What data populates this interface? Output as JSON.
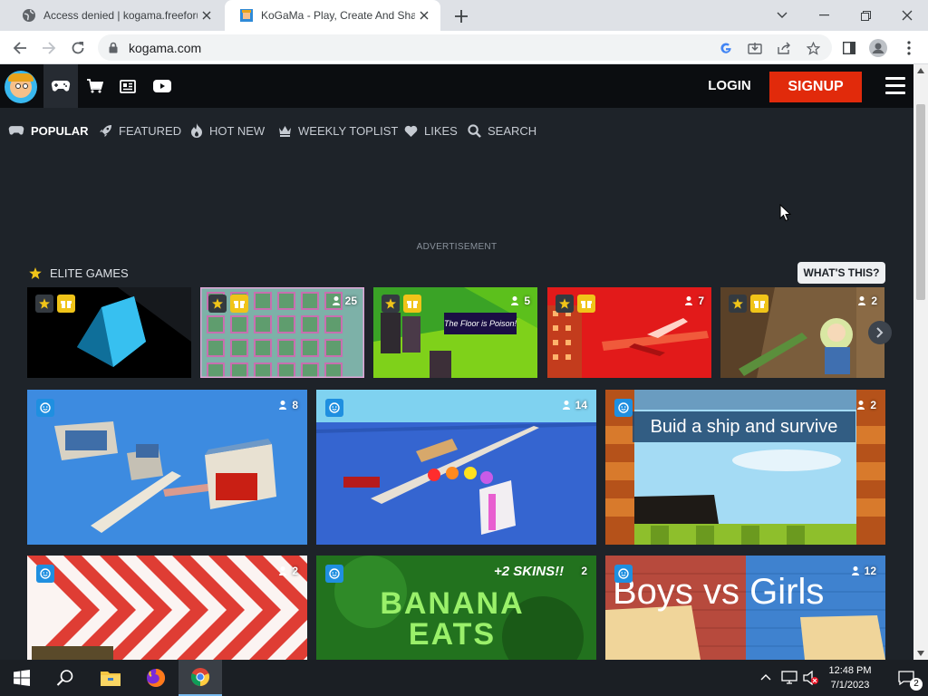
{
  "browser": {
    "tabs": [
      {
        "title": "Access denied | kogama.freeforu",
        "active": false
      },
      {
        "title": "KoGaMa - Play, Create And Share",
        "active": true
      }
    ],
    "url": "kogama.com"
  },
  "header": {
    "login_label": "LOGIN",
    "signup_label": "SIGNUP",
    "accent": "#e12a0b"
  },
  "filters": [
    {
      "label": "POPULAR",
      "icon": "gamepad-icon",
      "active": true
    },
    {
      "label": "FEATURED",
      "icon": "rocket-icon",
      "active": false
    },
    {
      "label": "HOT NEW",
      "icon": "fire-icon",
      "active": false
    },
    {
      "label": "WEEKLY TOPLIST",
      "icon": "crown-icon",
      "active": false
    },
    {
      "label": "LIKES",
      "icon": "heart-icon",
      "active": false
    },
    {
      "label": "SEARCH",
      "icon": "search-icon",
      "active": false
    }
  ],
  "ad_label": "ADVERTISEMENT",
  "elite": {
    "title": "ELITE GAMES",
    "whats_this": "WHAT'S THIS?",
    "cards": [
      {
        "players": ""
      },
      {
        "players": "25"
      },
      {
        "players": "5",
        "caption": "The Floor is Poison!"
      },
      {
        "players": "7"
      },
      {
        "players": "2"
      }
    ]
  },
  "games": [
    {
      "players": "8"
    },
    {
      "players": "14"
    },
    {
      "players": "2",
      "caption": "Buid a ship and survive"
    },
    {
      "players": "2"
    },
    {
      "players": "2",
      "caption": "+2 SKINS!!",
      "art_text": "BANANA EATS"
    },
    {
      "players": "12",
      "caption": "Boys vs Girls"
    }
  ],
  "taskbar": {
    "time": "12:48 PM",
    "date": "7/1/2023",
    "notifications": "2"
  }
}
